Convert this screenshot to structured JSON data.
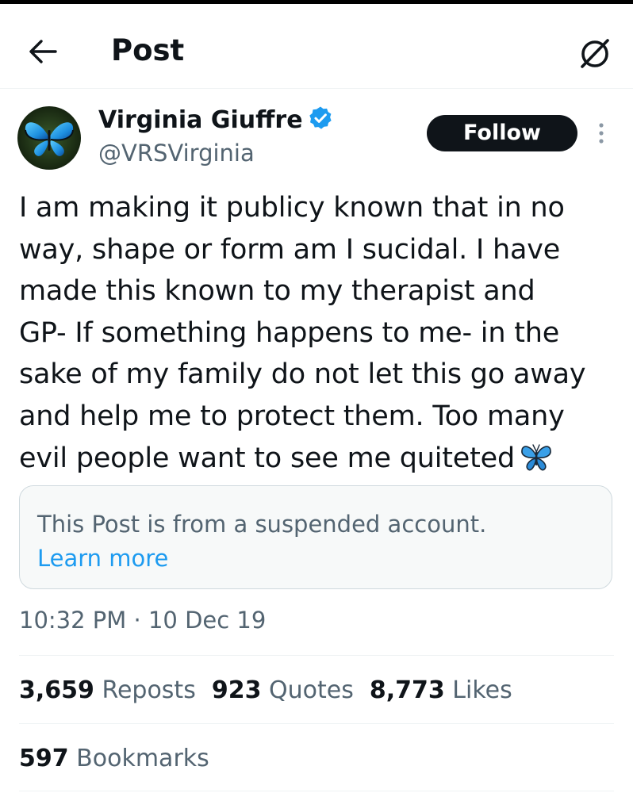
{
  "header": {
    "title": "Post",
    "back_icon": "arrow-left-icon",
    "grok_icon": "grok-icon"
  },
  "author": {
    "name": "Virginia Giuffre",
    "handle": "@VRSVirginia",
    "verified_icon": "verified-badge-icon",
    "verified_color": "#1d9bf0",
    "avatar_icon": "blue-butterfly-avatar"
  },
  "follow_button": {
    "label": "Follow"
  },
  "more_icon": "more-vertical-icon",
  "tweet": {
    "lines": [
      "I am making it publicy known that in no",
      "way, shape or form am I sucidal. I have",
      "made this known to my therapist and",
      "GP- If something happens to me- in the",
      "sake of my family do not let this go away",
      "and help me to protect them. Too many",
      "evil people want to see me quiteted"
    ],
    "emoji": "blue-butterfly-emoji"
  },
  "notice": {
    "text": "This Post is from a suspended account.",
    "link": "Learn more"
  },
  "timestamp": {
    "time": "10:32 PM",
    "separator": "·",
    "date": "10 Dec 19"
  },
  "stats": [
    {
      "count": "3,659",
      "label": "Reposts"
    },
    {
      "count": "923",
      "label": "Quotes"
    },
    {
      "count": "8,773",
      "label": "Likes"
    }
  ],
  "bookmarks": {
    "count": "597",
    "label": "Bookmarks"
  },
  "colors": {
    "text_primary": "#0f1419",
    "text_secondary": "#536471",
    "link": "#1d9bf0",
    "divider": "#eff3f4"
  }
}
